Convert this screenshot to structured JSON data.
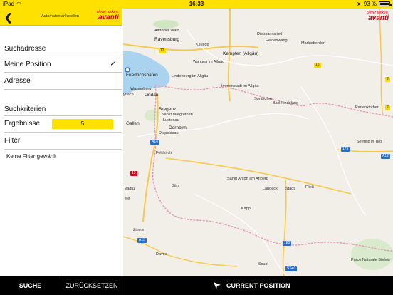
{
  "status": {
    "device": "iPad",
    "time": "16:33",
    "battery": "93 %"
  },
  "sidebar": {
    "title": "Automatentankstellen",
    "brand_tagline": "clever tanken.",
    "brand_name": "avanti",
    "search_section": "Suchadresse",
    "option_position": "Meine Position",
    "option_address": "Adresse",
    "criteria_section": "Suchkriterien",
    "results_label": "Ergebnisse",
    "results_value": "5",
    "filter_label": "Filter",
    "filter_text": "Keine Filter gewählt"
  },
  "map": {
    "brand_tagline": "clever tanken.",
    "brand_name": "avanti",
    "labels": {
      "altdorfer": "Altdorfer Wald",
      "ravensburg": "Ravensburg",
      "kisslegg": "Kißlegg",
      "dietmannsried": "Dietmannsried",
      "heldenwang": "Heldenwang",
      "marktoberdorf": "Marktoberdorf",
      "kempten": "Kempten (Allgäu)",
      "friedrichshafen": "Friedrichshafen",
      "lindenberg": "Lindenberg im Allgäu",
      "wangen": "Wangen im Allgäu",
      "immenstadt": "Immenstadt im Allgäu",
      "wasserburg": "Wasserburg",
      "lindau": "Lindau",
      "bregenz": "Bregenz",
      "sonthofen": "Sonthofen",
      "badhindelang": "Bad Hindelang",
      "stmargrethen": "Sankt Margrethen",
      "lustenau": "Lustenau",
      "dornbirn": "Dornbirn",
      "diepoldsau": "Diepoldsau",
      "gallen": "Gallen",
      "feldkirch": "Feldkirch",
      "vaduz": "Vaduz",
      "bludenz": "Bürs",
      "stanton": "Sankt Anton am Arlberg",
      "landeck": "Landeck",
      "stadt": "Stadt",
      "fliess": "Fließ",
      "kappl": "Kappl",
      "seefeld": "Seefeld in Tirol",
      "garmisch": "Partenkirchen",
      "zizers": "Zizers",
      "davos": "Davos",
      "scuol": "Scuol",
      "parco": "Parco Naturale Stelvio",
      "ynach": "ynach",
      "ele": "ele"
    },
    "roads": {
      "r12": "12",
      "r16": "16",
      "r2": "2",
      "r179": "179",
      "r180": "180",
      "r13": "13",
      "a14": "A14",
      "a13": "A13",
      "a12": "A12",
      "s540": "SS40",
      "r2b": "2"
    }
  },
  "bottom": {
    "search": "SUCHE",
    "reset": "ZURÜCKSETZEN",
    "current": "CURRENT POSITION"
  },
  "colors": {
    "accent": "#ffe100",
    "brand_red": "#d6001c"
  }
}
